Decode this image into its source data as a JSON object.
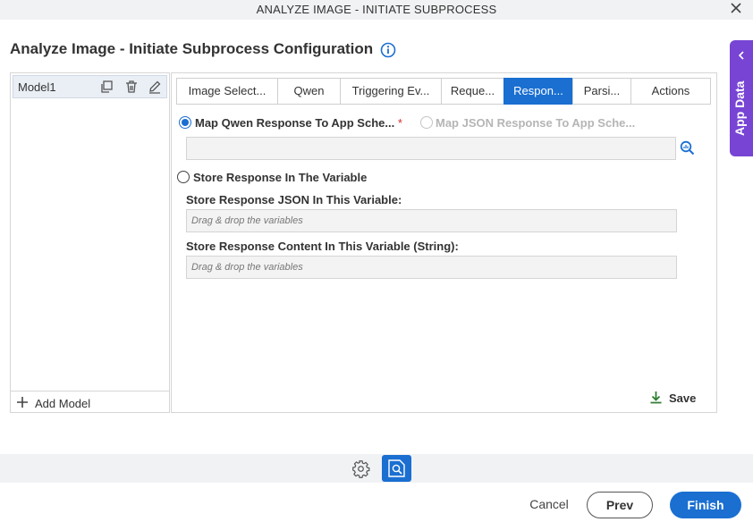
{
  "window": {
    "title": "ANALYZE IMAGE - INITIATE SUBPROCESS"
  },
  "page": {
    "heading": "Analyze Image - Initiate Subprocess Configuration"
  },
  "side_tab": {
    "label": "App Data"
  },
  "models": {
    "items": [
      {
        "label": "Model1"
      }
    ],
    "add_label": "Add Model"
  },
  "tabs": [
    {
      "label": "Image Select...",
      "active": false
    },
    {
      "label": "Qwen",
      "active": false
    },
    {
      "label": "Triggering Ev...",
      "active": false
    },
    {
      "label": "Reque...",
      "active": false
    },
    {
      "label": "Respon...",
      "active": true
    },
    {
      "label": "Parsi...",
      "active": false
    },
    {
      "label": "Actions",
      "active": false
    }
  ],
  "response": {
    "option_map_qwen": "Map Qwen Response To App Sche...",
    "required_mark": "*",
    "option_map_json": "Map JSON Response To App Sche...",
    "option_store": "Store Response In The Variable",
    "json_var_label": "Store Response JSON In This Variable:",
    "json_var_placeholder": "Drag & drop the variables",
    "content_var_label": "Store Response Content In This Variable (String):",
    "content_var_placeholder": "Drag & drop the variables",
    "selected_option": "map_qwen"
  },
  "actions": {
    "save": "Save",
    "cancel": "Cancel",
    "prev": "Prev",
    "finish": "Finish"
  },
  "colors": {
    "accent": "#1a6fd1",
    "side_tab": "#7744d4",
    "save_icon": "#2e7d32",
    "required": "#d32f2f"
  }
}
